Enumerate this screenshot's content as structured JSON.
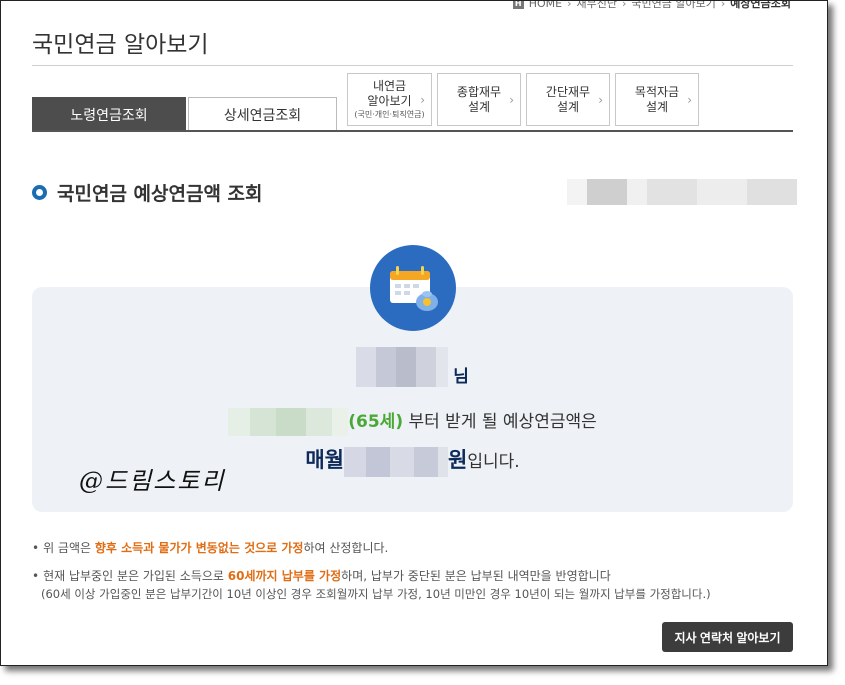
{
  "breadcrumb": {
    "home_badge": "H",
    "items": [
      "HOME",
      "재무진단",
      "국민연금 알아보기",
      "예상연금조회"
    ]
  },
  "page": {
    "title": "국민연금 알아보기"
  },
  "tabs": {
    "main": [
      {
        "label": "노령연금조회",
        "active": true
      },
      {
        "label": "상세연금조회",
        "active": false
      }
    ],
    "sub": [
      {
        "line1": "내연금",
        "line2": "알아보기",
        "line3": "(국민·개인·퇴직연금)"
      },
      {
        "line1": "종합재무",
        "line2": "설계"
      },
      {
        "line1": "간단재무",
        "line2": "설계"
      },
      {
        "line1": "목적자금",
        "line2": "설계"
      }
    ]
  },
  "section": {
    "title": "국민연금 예상연금액 조회"
  },
  "result": {
    "name_suffix": "님",
    "age_text": "(65세)",
    "age_suffix": " 부터 받게 될 예상연금액은",
    "monthly_label": "매월",
    "won_label": "원",
    "ending": "입니다."
  },
  "watermark": "@드림스토리",
  "notes": {
    "n1_pre": "위 금액은 ",
    "n1_hl": "향후 소득과 물가가 변동없는 것으로 가정",
    "n1_post": "하여 산정합니다.",
    "n2_pre": "현재 납부중인 분은 가입된 소득으로 ",
    "n2_hl": "60세까지 납부를 가정",
    "n2_post": "하며, 납부가 중단된 분은 납부된 내역만을 반영합니다",
    "n2_sub": "(60세 이상 가입중인 분은 납부기간이 10년 이상인 경우 조회월까지 납부 가정, 10년 미만인 경우 10년이 되는 월까지 납부를 가정합니다.)"
  },
  "contact_button": "지사 연락처 알아보기",
  "colors": {
    "accent_blue": "#1b6db3",
    "highlight_orange": "#e06d14",
    "age_green": "#4aa837",
    "navy": "#0e2a5b"
  }
}
